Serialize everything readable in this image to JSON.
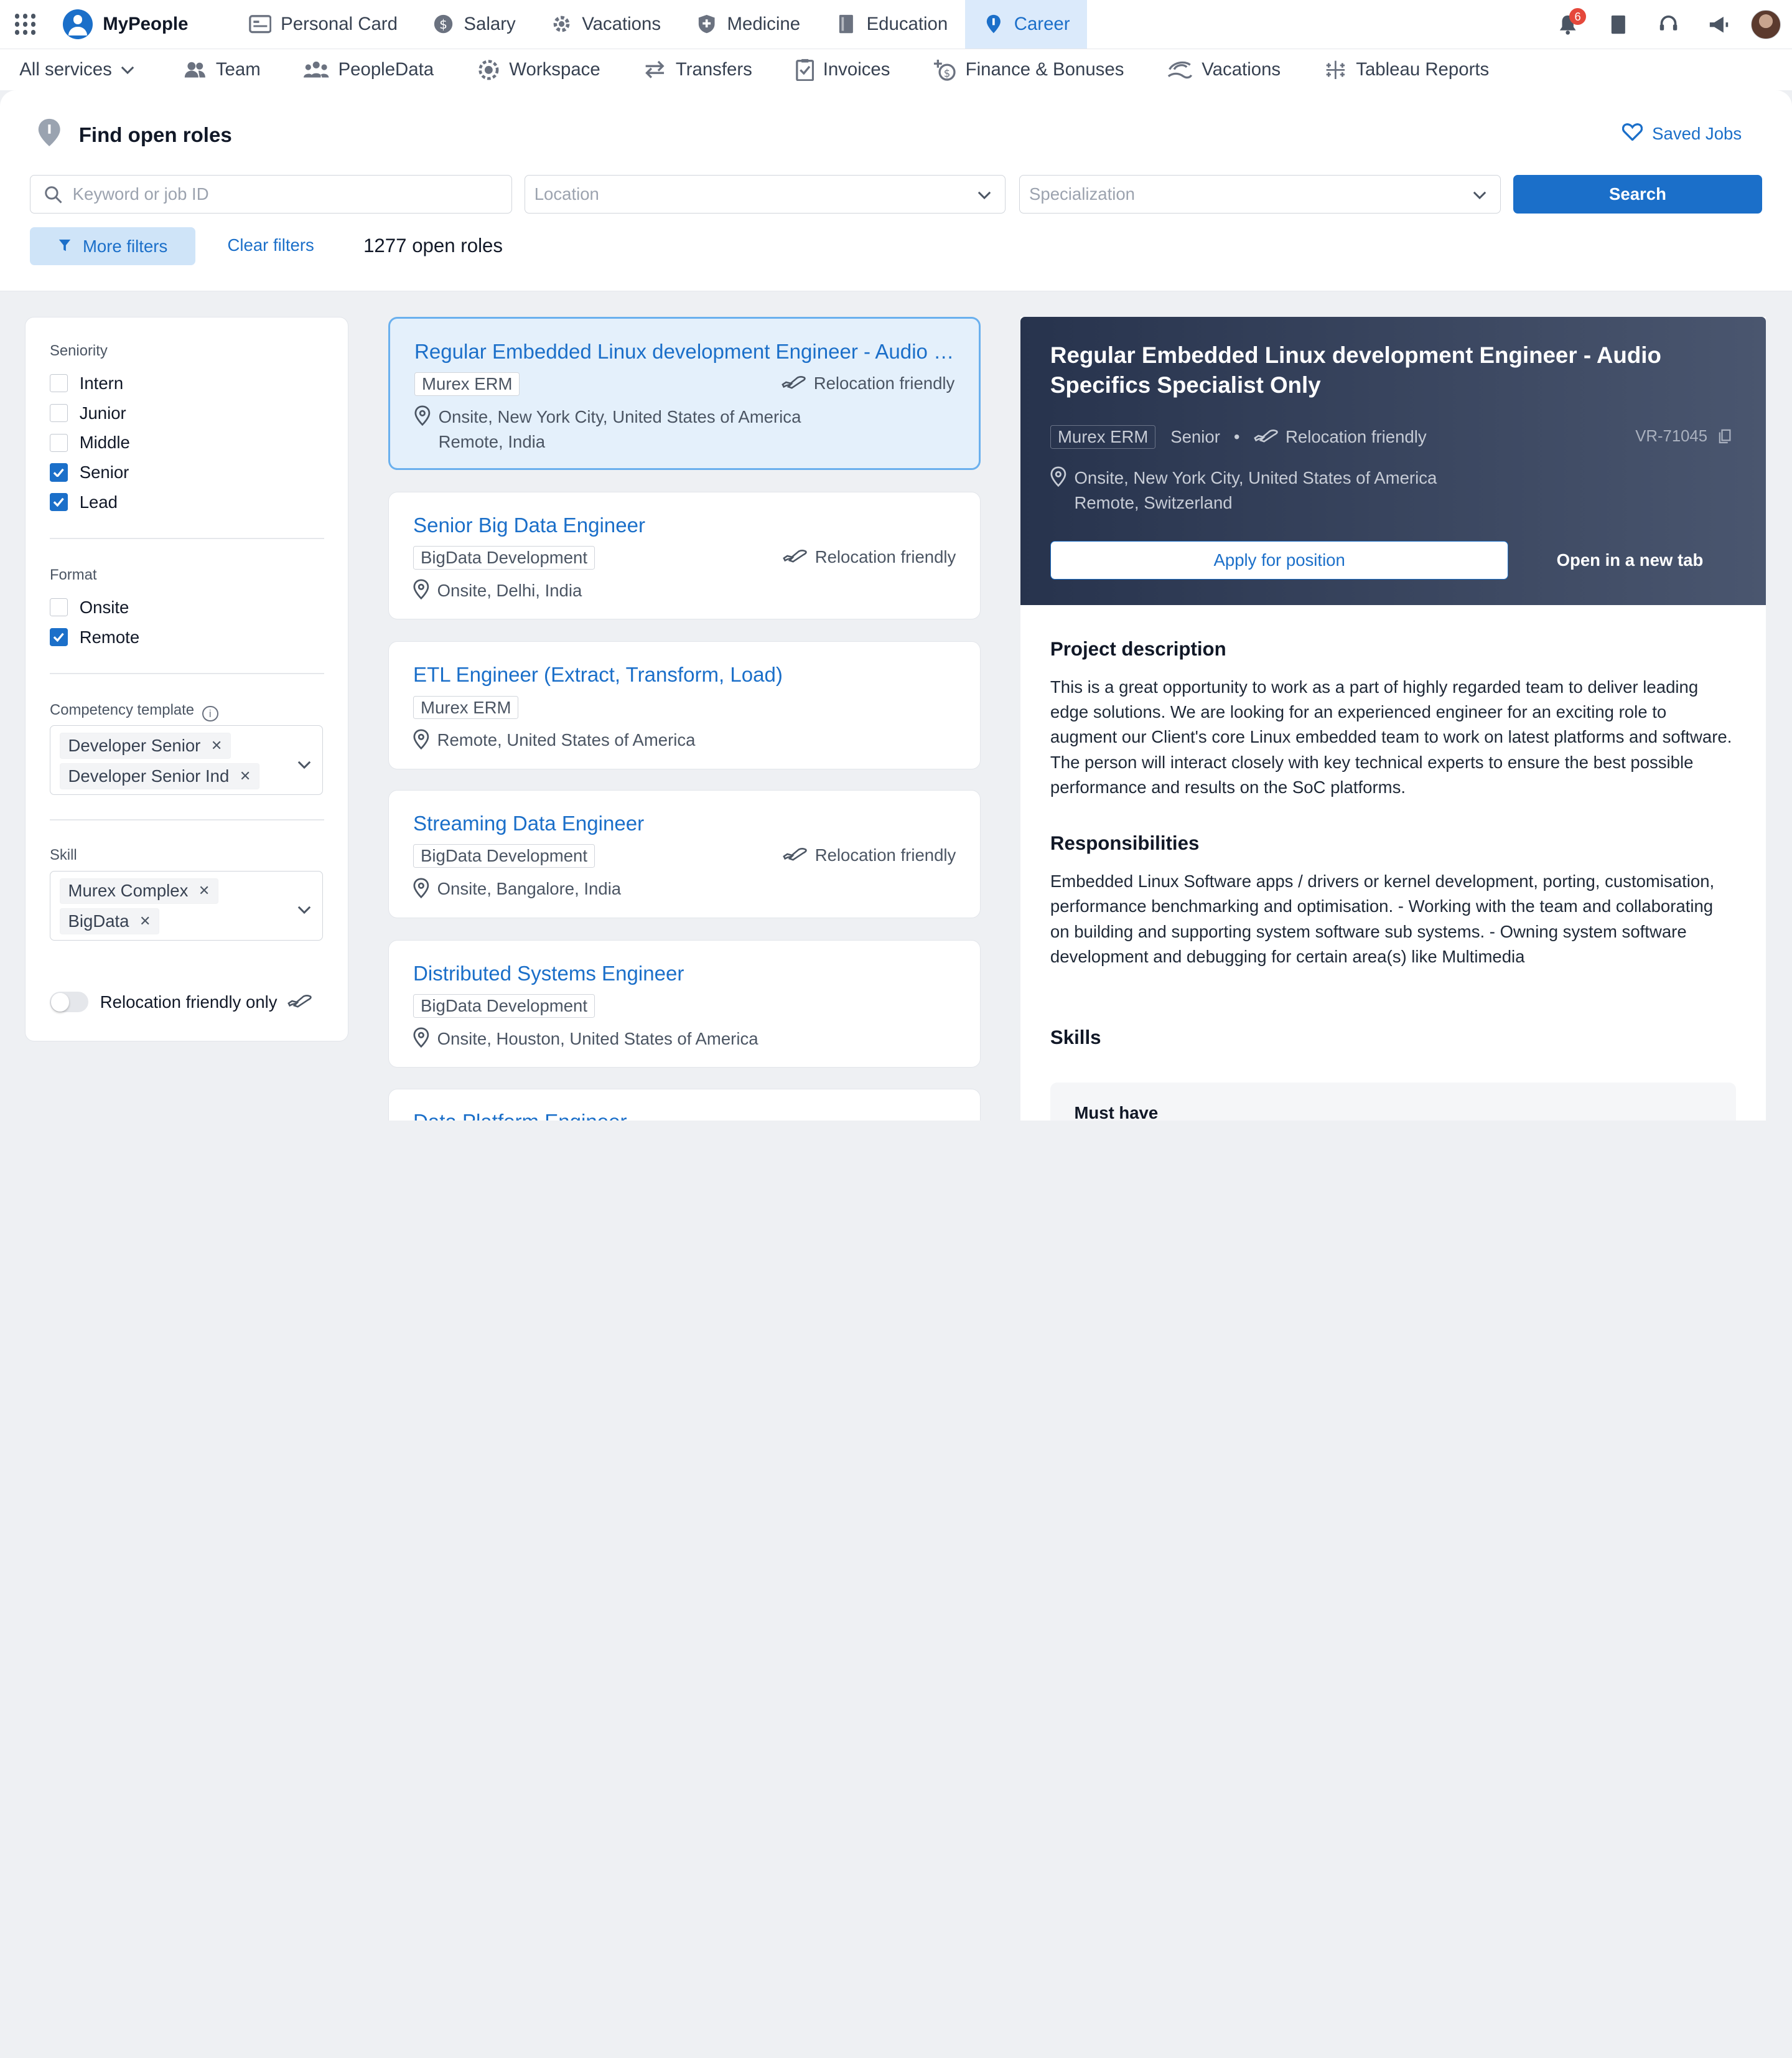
{
  "brand": {
    "name": "MyPeople"
  },
  "main_nav": [
    {
      "label": "Personal Card",
      "icon": "id-card-icon"
    },
    {
      "label": "Salary",
      "icon": "dollar-icon"
    },
    {
      "label": "Vacations",
      "icon": "gear-icon"
    },
    {
      "label": "Medicine",
      "icon": "shield-plus-icon"
    },
    {
      "label": "Education",
      "icon": "book-icon"
    },
    {
      "label": "Career",
      "icon": "pin-icon",
      "active": true
    }
  ],
  "top_right": {
    "notifications_count": "6"
  },
  "sub_nav": {
    "all_services": "All services",
    "items": [
      {
        "label": "Team",
        "icon": "team-icon"
      },
      {
        "label": "PeopleData",
        "icon": "people-icon"
      },
      {
        "label": "Workspace",
        "icon": "workspace-icon"
      },
      {
        "label": "Transfers",
        "icon": "transfer-icon"
      },
      {
        "label": "Invoices",
        "icon": "invoice-icon"
      },
      {
        "label": "Finance & Bonuses",
        "icon": "finance-icon"
      },
      {
        "label": "Vacations",
        "icon": "vacation-icon"
      },
      {
        "label": "Tableau Reports",
        "icon": "tableau-icon"
      }
    ]
  },
  "search": {
    "title": "Find open roles",
    "saved_jobs": "Saved Jobs",
    "keyword_placeholder": "Keyword or job ID",
    "location_placeholder": "Location",
    "specialization_placeholder": "Specialization",
    "search_button": "Search",
    "more_filters": "More filters",
    "clear_filters": "Clear filters",
    "count": "1277",
    "count_suffix": " open roles"
  },
  "filters": {
    "seniority_title": "Seniority",
    "seniority": [
      {
        "label": "Intern",
        "checked": false
      },
      {
        "label": "Junior",
        "checked": false
      },
      {
        "label": "Middle",
        "checked": false
      },
      {
        "label": "Senior",
        "checked": true
      },
      {
        "label": "Lead",
        "checked": true
      }
    ],
    "format_title": "Format",
    "format": [
      {
        "label": "Onsite",
        "checked": false
      },
      {
        "label": "Remote",
        "checked": true
      }
    ],
    "competency_title": "Competency template",
    "competency_chips": [
      "Developer Senior",
      "Developer Senior Ind"
    ],
    "skill_title": "Skill",
    "skill_chips": [
      "Murex Complex",
      "BigData"
    ],
    "relocation_toggle": "Relocation friendly only"
  },
  "jobs": [
    {
      "title": "Regular Embedded Linux development Engineer - Audio Specifics Specialist Only",
      "tag": "Murex ERM",
      "relocation": "Relocation friendly",
      "locations": [
        "Onsite, New York City, United States of America",
        "Remote, India"
      ]
    },
    {
      "title": "Senior Big Data Engineer",
      "tag": "BigData Development",
      "relocation": "Relocation friendly",
      "locations": [
        "Onsite, Delhi, India"
      ]
    },
    {
      "title": "ETL Engineer (Extract, Transform, Load)",
      "tag": "Murex ERM",
      "relocation": "",
      "locations": [
        "Remote, United States of America"
      ]
    },
    {
      "title": "Streaming Data Engineer",
      "tag": "BigData Development",
      "relocation": "Relocation friendly",
      "locations": [
        "Onsite, Bangalore, India"
      ]
    },
    {
      "title": "Distributed Systems Engineer",
      "tag": "BigData Development",
      "relocation": "",
      "locations": [
        "Onsite, Houston, United States of America"
      ]
    },
    {
      "title": "Data Platform Engineer",
      "tag": "",
      "relocation": "",
      "locations": []
    }
  ],
  "details": {
    "title": "Regular Embedded Linux development Engineer - Audio Specifics Specialist Only",
    "tag": "Murex ERM",
    "seniority": "Senior",
    "dot": "•",
    "relocation": "Relocation friendly",
    "job_id": "VR-71045",
    "locations": [
      "Onsite, New York City, United States of America",
      "Remote, Switzerland"
    ],
    "apply": "Apply for position",
    "open_new_tab": "Open in a new tab",
    "project_title": "Project description",
    "project_text": "This is a great opportunity to work as a part of highly regarded team to deliver leading edge solutions. We are looking for an experienced engineer for an exciting role to augment our Client's core Linux embedded team to work on latest platforms and software. The person will interact closely with key technical experts to ensure the best possible performance and results on the SoC platforms.",
    "resp_title": "Responsibilities",
    "resp_text": "Embedded Linux Software apps / drivers or kernel development, porting, customisation, performance benchmarking and optimisation. - Working with the team and collaborating on building and supporting system software sub systems. - Owning system software development and debugging for certain area(s) like Multimedia",
    "skills_title": "Skills",
    "must_have": "Must have"
  }
}
